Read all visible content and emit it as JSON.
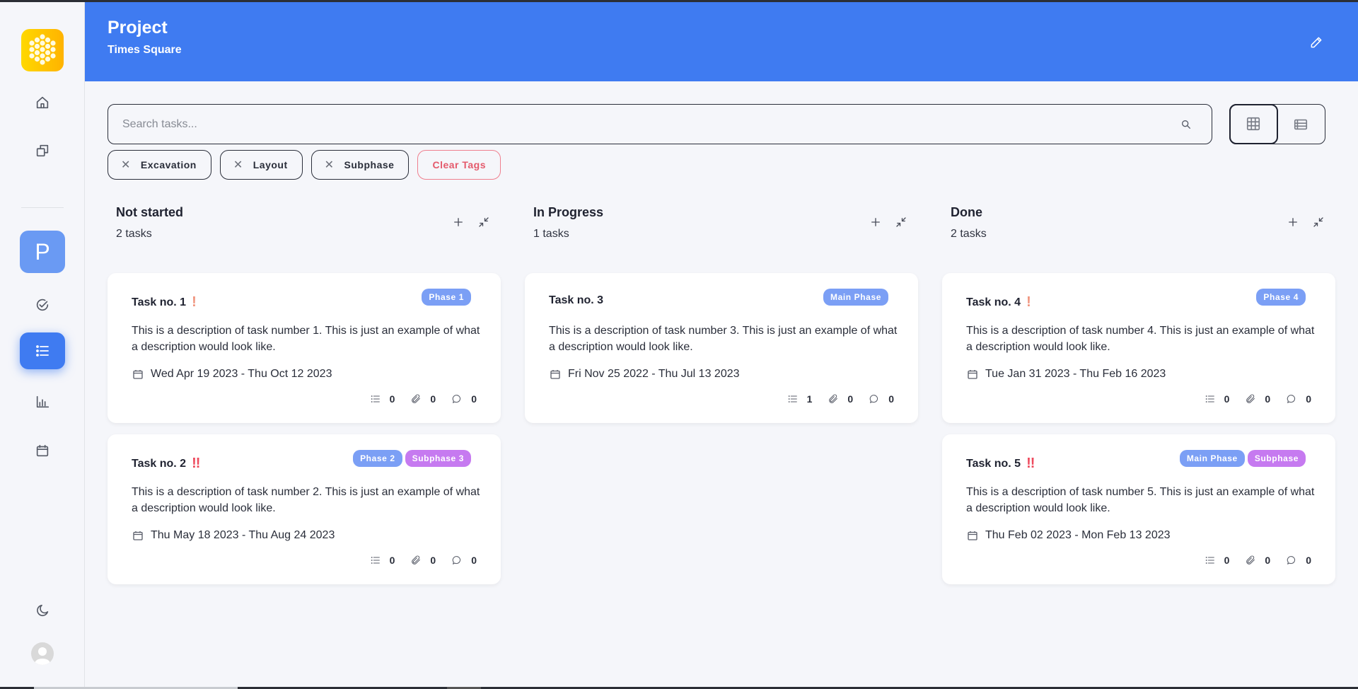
{
  "header": {
    "title": "Project",
    "subtitle": "Times Square",
    "edit_icon": "pencil-icon"
  },
  "sidebar": {
    "logo": "honeycomb-logo",
    "items": [
      {
        "name": "home",
        "icon": "home-icon"
      },
      {
        "name": "projects",
        "icon": "copy-icon"
      },
      {
        "name": "project",
        "label": "P"
      },
      {
        "name": "tasks-check",
        "icon": "check-circle-icon"
      },
      {
        "name": "task-list",
        "icon": "list-icon",
        "active": true
      },
      {
        "name": "reports",
        "icon": "bar-chart-icon"
      },
      {
        "name": "calendar",
        "icon": "calendar-icon"
      }
    ],
    "bottom": [
      {
        "name": "theme-toggle",
        "icon": "moon-icon"
      },
      {
        "name": "user",
        "icon": "user-avatar-icon"
      }
    ]
  },
  "search": {
    "placeholder": "Search tasks...",
    "value": ""
  },
  "view_toggle": {
    "options": [
      "grid",
      "list"
    ],
    "selected": "grid"
  },
  "tags": [
    {
      "label": "Excavation"
    },
    {
      "label": "Layout"
    },
    {
      "label": "Subphase"
    }
  ],
  "clear_tags_label": "Clear Tags",
  "colors": {
    "accent": "#3f7bf1",
    "phase_badge": "#7b9ff5",
    "subphase_badge": "#c67af0",
    "priority_low": "#f0957f",
    "priority_high": "#ee4b5e",
    "clear_tags": "#e45a6c"
  },
  "columns": [
    {
      "title": "Not started",
      "count": "2 tasks",
      "tasks": [
        {
          "name": "Task no. 1",
          "priority": "!",
          "priority_level": "low",
          "badges": [
            {
              "label": "Phase 1",
              "type": "phase"
            }
          ],
          "description": "This is a description of task number 1. This is just an example of what a description would look like.",
          "dates": "Wed Apr 19 2023 - Thu Oct 12 2023",
          "subtasks": "0",
          "attachments": "0",
          "comments": "0"
        },
        {
          "name": "Task no. 2",
          "priority": "!!",
          "priority_level": "high",
          "badges": [
            {
              "label": "Phase 2",
              "type": "phase"
            },
            {
              "label": "Subphase 3",
              "type": "subphase"
            }
          ],
          "description": "This is a description of task number 2. This is just an example of what a description would look like.",
          "dates": "Thu May 18 2023 - Thu Aug 24 2023",
          "subtasks": "0",
          "attachments": "0",
          "comments": "0"
        }
      ]
    },
    {
      "title": "In Progress",
      "count": "1 tasks",
      "tasks": [
        {
          "name": "Task no. 3",
          "priority": "",
          "priority_level": "none",
          "badges": [
            {
              "label": "Main Phase",
              "type": "phase"
            }
          ],
          "description": "This is a description of task number 3. This is just an example of what a description would look like.",
          "dates": "Fri Nov 25 2022 - Thu Jul 13 2023",
          "subtasks": "1",
          "attachments": "0",
          "comments": "0"
        }
      ]
    },
    {
      "title": "Done",
      "count": "2 tasks",
      "tasks": [
        {
          "name": "Task no. 4",
          "priority": "!",
          "priority_level": "low",
          "badges": [
            {
              "label": "Phase 4",
              "type": "phase"
            }
          ],
          "description": "This is a description of task number 4. This is just an example of what a description would look like.",
          "dates": "Tue Jan 31 2023 - Thu Feb 16 2023",
          "subtasks": "0",
          "attachments": "0",
          "comments": "0"
        },
        {
          "name": "Task no. 5",
          "priority": "!!",
          "priority_level": "high",
          "badges": [
            {
              "label": "Main Phase",
              "type": "phase"
            },
            {
              "label": "Subphase",
              "type": "subphase"
            }
          ],
          "description": "This is a description of task number 5. This is just an example of what a description would look like.",
          "dates": "Thu Feb 02 2023 - Mon Feb 13 2023",
          "subtasks": "0",
          "attachments": "0",
          "comments": "0"
        }
      ]
    }
  ]
}
